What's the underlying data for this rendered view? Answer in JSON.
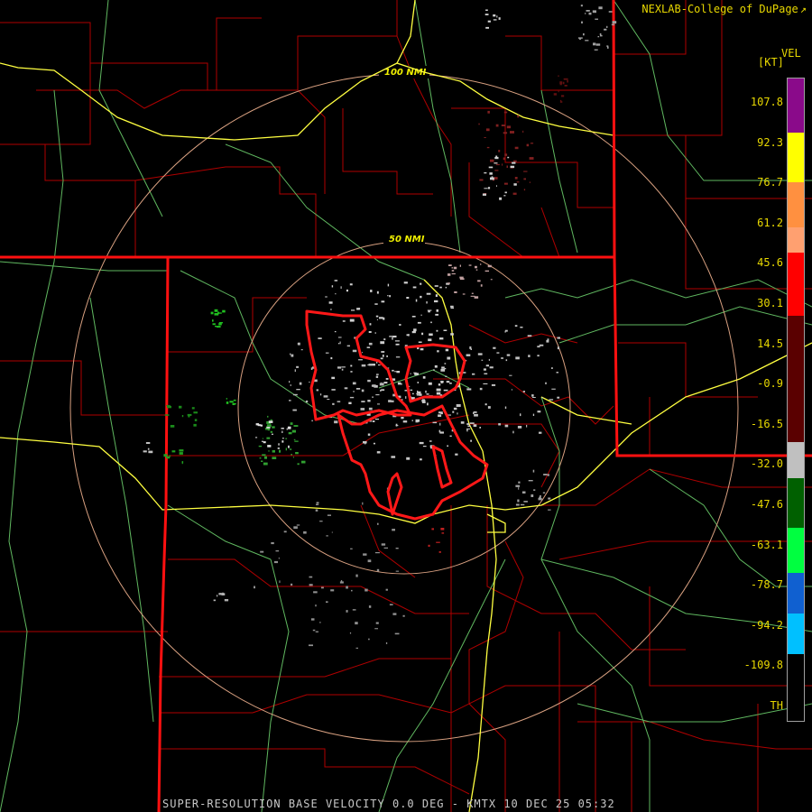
{
  "header": {
    "brand": "NEXLAB-College of DuPage",
    "brand_icon": "external-link-icon"
  },
  "legend": {
    "title": "VEL",
    "unit": "[KT]",
    "ticks": [
      "107.8",
      "92.3",
      "76.7",
      "61.2",
      "45.6",
      "30.1",
      "14.5",
      "-0.9",
      "-16.5",
      "-32.0",
      "-47.6",
      "-63.1",
      "-78.7",
      "-94.2",
      "-109.8",
      "TH"
    ],
    "colors": {
      "purple": "#8a0a8a",
      "yellow": "#ffff00",
      "orange": "#ff9040",
      "salmon": "#ffa070",
      "red": "#ff0000",
      "darkred": "#5a0000",
      "gray": "#c0c0c0",
      "darkgreen": "#006000",
      "green": "#00ff40",
      "blue": "#1060d0",
      "lightblue": "#00c0ff",
      "black": "#000000"
    }
  },
  "map": {
    "range_rings": [
      "50 NMI",
      "100 NMI"
    ],
    "colors": {
      "state_border": "#ff1010",
      "county_line": "#c00000",
      "highway": "#ffff40",
      "road": "#70c070",
      "ring": "#d8a080",
      "warning": "#ff1818"
    }
  },
  "footer": {
    "product": "SUPER-RESOLUTION BASE VELOCITY 0.0 DEG - KMTX 10 DEC 25 05:32"
  }
}
